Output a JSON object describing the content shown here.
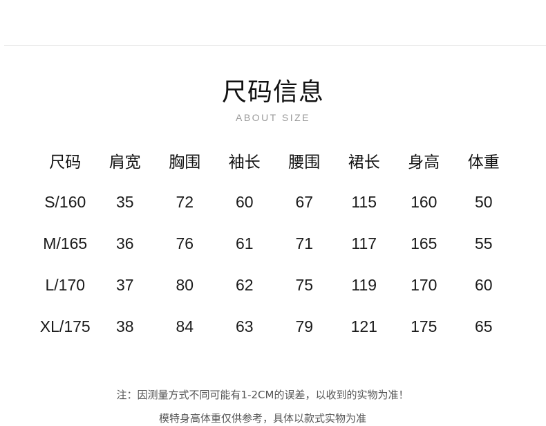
{
  "header": {
    "title": "尺码信息",
    "subtitle": "ABOUT SIZE"
  },
  "table": {
    "columns": [
      "尺码",
      "肩宽",
      "胸围",
      "袖长",
      "腰围",
      "裙长",
      "身高",
      "体重"
    ],
    "rows": [
      [
        "S/160",
        "35",
        "72",
        "60",
        "67",
        "115",
        "160",
        "50"
      ],
      [
        "M/165",
        "36",
        "76",
        "61",
        "71",
        "117",
        "165",
        "55"
      ],
      [
        "L/170",
        "37",
        "80",
        "62",
        "75",
        "119",
        "170",
        "60"
      ],
      [
        "XL/175",
        "38",
        "84",
        "63",
        "79",
        "121",
        "175",
        "65"
      ]
    ]
  },
  "notes": {
    "line1": "注：因测量方式不同可能有1-2CM的误差，以收到的实物为准！",
    "line2": "模特身高体重仅供参考，具体以款式实物为准"
  },
  "colors": {
    "text": "#1a1a1a",
    "subtitle": "#9a9a9a",
    "note": "#555555",
    "divider": "#e6e6e6"
  }
}
